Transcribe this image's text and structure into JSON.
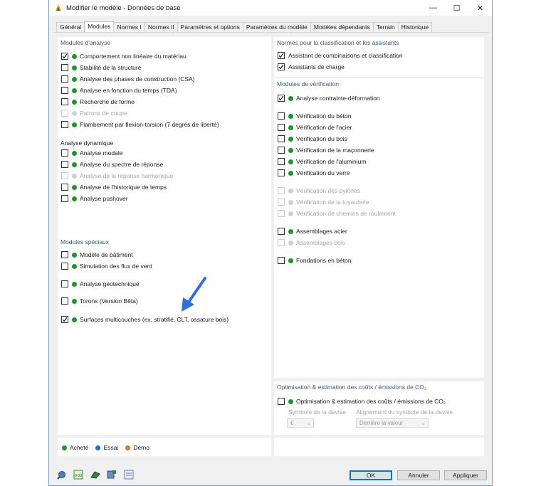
{
  "window": {
    "title": "Modifier le modèle - Données de base",
    "controls": [
      "—",
      "☐",
      "✕"
    ]
  },
  "tabs": [
    {
      "label": "Général",
      "active": false
    },
    {
      "label": "Modules",
      "active": true
    },
    {
      "label": "Normes I",
      "active": false
    },
    {
      "label": "Normes II",
      "active": false
    },
    {
      "label": "Paramètres et options",
      "active": false
    },
    {
      "label": "Paramètres du modèle",
      "active": false
    },
    {
      "label": "Modèles dépendants",
      "active": false
    },
    {
      "label": "Terrain",
      "active": false
    },
    {
      "label": "Historique",
      "active": false
    }
  ],
  "analysis": {
    "title": "Modules d'analyse",
    "items": [
      {
        "label": "Comportement non linéaire du matériau",
        "checked": true,
        "status": "green",
        "enabled": true
      },
      {
        "label": "Stabilité de la structure",
        "checked": false,
        "status": "green",
        "enabled": true
      },
      {
        "label": "Analyse des phases de construction (CSA)",
        "checked": false,
        "status": "green",
        "enabled": true
      },
      {
        "label": "Analyse en fonction du temps (TDA)",
        "checked": false,
        "status": "green",
        "enabled": true
      },
      {
        "label": "Recherche de forme",
        "checked": false,
        "status": "green",
        "enabled": true
      },
      {
        "label": "Patrons de coupe",
        "checked": false,
        "status": "gray",
        "enabled": false
      },
      {
        "label": "Flambement par flexion-torsion (7 degrés de liberté)",
        "checked": false,
        "status": "green",
        "enabled": true
      }
    ],
    "dynamic_title": "Analyse dynamique",
    "dynamic_items": [
      {
        "label": "Analyse modale",
        "checked": false,
        "status": "green",
        "enabled": true
      },
      {
        "label": "Analyse du spectre de réponse",
        "checked": false,
        "status": "green",
        "enabled": true
      },
      {
        "label": "Analyse de la réponse harmonique",
        "checked": false,
        "status": "gray",
        "enabled": false
      },
      {
        "label": "Analyse de l'historique de temps",
        "checked": false,
        "status": "green",
        "enabled": true
      },
      {
        "label": "Analyse pushover",
        "checked": false,
        "status": "green",
        "enabled": true
      }
    ]
  },
  "special": {
    "title": "Modules spéciaux",
    "items": [
      {
        "label": "Modèle de bâtiment",
        "checked": false,
        "status": "green",
        "enabled": true
      },
      {
        "label": "Simulation des flux de vent",
        "checked": false,
        "status": "green",
        "enabled": true
      },
      {
        "label": "Analyse géotechnique",
        "checked": false,
        "status": "green",
        "enabled": true
      },
      {
        "label": "Torons (Version Bêta)",
        "checked": false,
        "status": "green",
        "enabled": true
      },
      {
        "label": "Surfaces multicouches (ex. stratifié, CLT, ossature bois)",
        "checked": true,
        "status": "green",
        "enabled": true
      }
    ]
  },
  "norms": {
    "title": "Normes pour la classification et les assistants",
    "items": [
      {
        "label": "Assistant de combinaisons et classification",
        "checked": true
      },
      {
        "label": "Assistants de charge",
        "checked": true
      }
    ]
  },
  "verification": {
    "title": "Modules de vérification",
    "items": [
      {
        "label": "Analyse contrainte-déformation",
        "checked": true,
        "status": "green",
        "enabled": true
      },
      {
        "label": "Vérification du béton",
        "checked": false,
        "status": "green",
        "enabled": true
      },
      {
        "label": "Vérification de l'acier",
        "checked": false,
        "status": "green",
        "enabled": true
      },
      {
        "label": "Vérification du bois",
        "checked": false,
        "status": "green",
        "enabled": true
      },
      {
        "label": "Vérification de la maçonnerie",
        "checked": false,
        "status": "green",
        "enabled": true
      },
      {
        "label": "Vérification de l'aluminium",
        "checked": false,
        "status": "green",
        "enabled": true
      },
      {
        "label": "Vérification du verre",
        "checked": false,
        "status": "green",
        "enabled": true
      },
      {
        "label": "Vérification des pylônes",
        "checked": false,
        "status": "gray",
        "enabled": false
      },
      {
        "label": "Vérification de la tuyauterie",
        "checked": false,
        "status": "gray",
        "enabled": false
      },
      {
        "label": "Vérification de chemins de roulement",
        "checked": false,
        "status": "gray",
        "enabled": false
      },
      {
        "label": "Assemblages acier",
        "checked": false,
        "status": "green",
        "enabled": true
      },
      {
        "label": "Assemblages bois",
        "checked": false,
        "status": "gray",
        "enabled": false
      },
      {
        "label": "Fondations en béton",
        "checked": false,
        "status": "green",
        "enabled": true
      }
    ]
  },
  "optimization": {
    "title": "Optimisation & estimation des coûts / émissions de CO₂",
    "item": {
      "label": "Optimisation & estimation des coûts / émissions de CO₂",
      "checked": false,
      "status": "green"
    },
    "currency_label": "Symbole de la devise",
    "currency_value": "€",
    "alignment_label": "Alignement du symbole de la devise",
    "alignment_value": "Derrière la valeur"
  },
  "legend": [
    {
      "label": "Acheté",
      "color": "#159b24"
    },
    {
      "label": "Essai",
      "color": "#1f6fd6"
    },
    {
      "label": "Démo",
      "color": "#e8731c"
    }
  ],
  "buttons": {
    "ok": "OK",
    "cancel": "Annuler",
    "apply": "Appliquer"
  },
  "toolbar_icons": [
    "help-search-icon",
    "units-icon",
    "render-icon",
    "save-settings-icon",
    "model-info-icon"
  ],
  "toolbar_units_text": "0.00",
  "accent_color": "#0078d7",
  "arrow_color": "#2e6fe0"
}
